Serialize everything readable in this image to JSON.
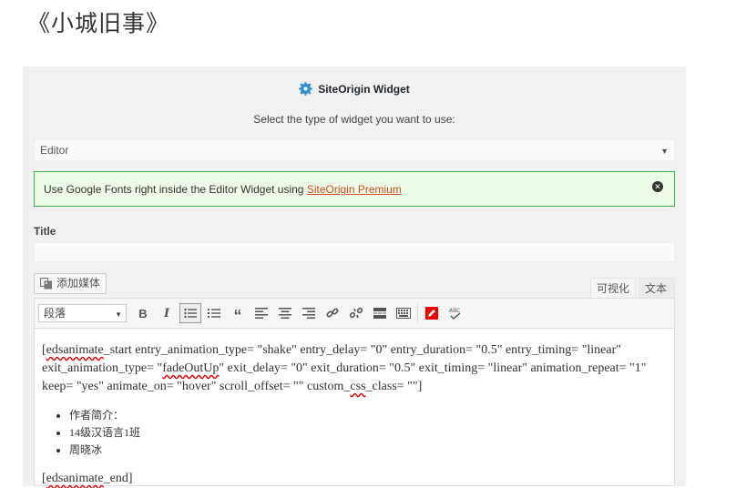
{
  "page": {
    "title": "《小城旧事》"
  },
  "widget": {
    "header": "SiteOrigin Widget",
    "prompt": "Select the type of widget you want to use:",
    "selected_type": "Editor",
    "notice_prefix": "Use Google Fonts right inside the Editor Widget using ",
    "notice_link": "SiteOrigin Premium",
    "title_label": "Title",
    "title_value": ""
  },
  "editor": {
    "add_media_label": "添加媒体",
    "tabs": {
      "visual": "可视化",
      "text": "文本"
    },
    "format_select": "段落",
    "content": {
      "shortcode_open_tag": "edsanimate",
      "shortcode_open_rest": "_start entry_animation_type= \"shake\" entry_delay= \"0\" entry_duration= \"0.5\" entry_timing= \"linear\" exit_animation_type= \"",
      "fade_value": "fadeOutUp",
      "shortcode_open_rest2": "\" exit_delay= \"0\" exit_duration= \"0.5\" exit_timing= \"linear\" animation_repeat= \"1\" keep= \"yes\" animate_on= \"hover\" scroll_offset= \"\" custom_",
      "css_word": "css",
      "shortcode_open_end": "_class= \"\"]",
      "list_items": [
        "作者简介：",
        "14级汉语言1班",
        "周晓冰"
      ],
      "shortcode_close_tag": "edsanimate",
      "shortcode_close_rest": "_end]"
    }
  }
}
